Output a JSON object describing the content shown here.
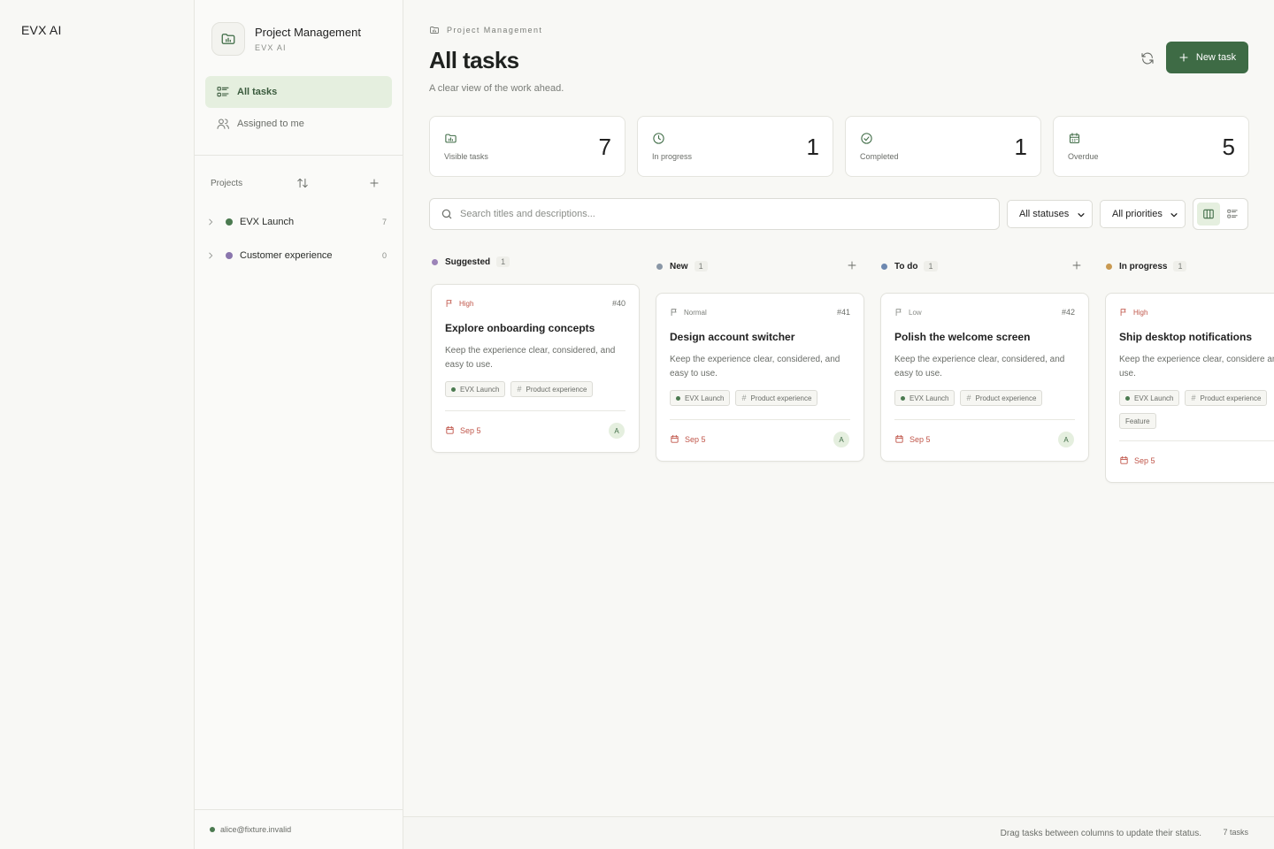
{
  "app": {
    "brand": "EVX AI"
  },
  "sidebar": {
    "workspace_title": "Project Management",
    "workspace_sub": "EVX AI",
    "nav": [
      {
        "label": "All tasks",
        "icon": "list-icon",
        "active": true
      },
      {
        "label": "Assigned to me",
        "icon": "users-icon",
        "active": false
      }
    ],
    "projects_label": "Projects",
    "projects": [
      {
        "name": "EVX Launch",
        "count": "7",
        "color": "#4b7a50"
      },
      {
        "name": "Customer experience",
        "count": "0",
        "color": "#8a76ad"
      }
    ],
    "user_email": "alice@fixture.invalid"
  },
  "header": {
    "breadcrumb": "Project Management",
    "title": "All tasks",
    "subtitle": "A clear view of the work ahead.",
    "new_task_label": "New task"
  },
  "stats": [
    {
      "label": "Visible tasks",
      "value": "7",
      "icon": "folder-icon"
    },
    {
      "label": "In progress",
      "value": "1",
      "icon": "clock-icon"
    },
    {
      "label": "Completed",
      "value": "1",
      "icon": "check-circle-icon"
    },
    {
      "label": "Overdue",
      "value": "5",
      "icon": "calendar-icon"
    }
  ],
  "filters": {
    "search_placeholder": "Search titles and descriptions...",
    "status": "All statuses",
    "priority": "All priorities",
    "view": "board"
  },
  "columns": [
    {
      "name": "Suggested",
      "count": "1",
      "color": "#9c84b8",
      "cards": [
        {
          "priority": "High",
          "priority_color": "#c0564a",
          "number": "#40",
          "title": "Explore onboarding concepts",
          "description": "Keep the experience clear, considered, and easy to use.",
          "project_tag": "EVX Launch",
          "tags": [
            "Product experience"
          ],
          "due": "Sep 5",
          "assignee": "A"
        }
      ]
    },
    {
      "name": "New",
      "count": "1",
      "color": "#8a97a6",
      "cards": [
        {
          "priority": "Normal",
          "priority_color": "#7a7d78",
          "number": "#41",
          "title": "Design account switcher",
          "description": "Keep the experience clear, considered, and easy to use.",
          "project_tag": "EVX Launch",
          "tags": [
            "Product experience"
          ],
          "due": "Sep 5",
          "assignee": "A"
        }
      ]
    },
    {
      "name": "To do",
      "count": "1",
      "color": "#6d88b0",
      "cards": [
        {
          "priority": "Low",
          "priority_color": "#8a8d88",
          "number": "#42",
          "title": "Polish the welcome screen",
          "description": "Keep the experience clear, considered, and easy to use.",
          "project_tag": "EVX Launch",
          "tags": [
            "Product experience"
          ],
          "due": "Sep 5",
          "assignee": "A"
        }
      ]
    },
    {
      "name": "In progress",
      "count": "1",
      "color": "#c99a52",
      "cards": [
        {
          "priority": "High",
          "priority_color": "#c0564a",
          "number": "",
          "title": "Ship desktop notifications",
          "description": "Keep the experience clear, considere and easy to use.",
          "project_tag": "EVX Launch",
          "tags": [
            "Product experience",
            "Feature"
          ],
          "due": "Sep 5",
          "assignee": ""
        }
      ]
    }
  ],
  "footer": {
    "hint": "Drag tasks between columns to update their status.",
    "task_count": "7 tasks"
  },
  "colors": {
    "accent": "#3e6b45",
    "accent_soft": "#e5efdf",
    "overdue": "#c0564a"
  }
}
